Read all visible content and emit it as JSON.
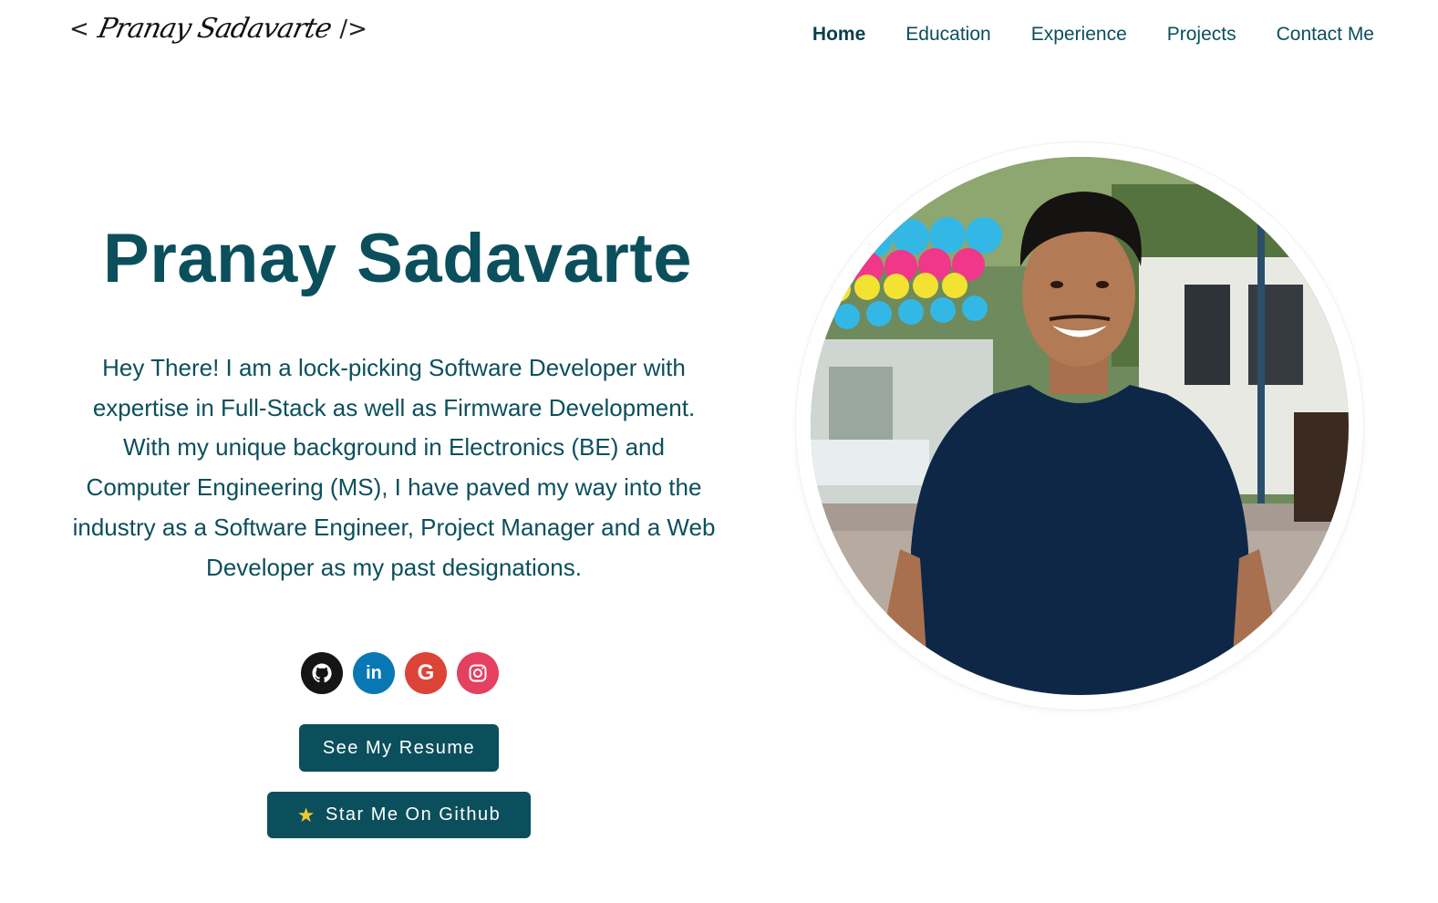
{
  "header": {
    "logo": {
      "open_bracket": "<",
      "signature": "Pranay Sadavarte",
      "close_bracket": "/>"
    },
    "nav": [
      {
        "label": "Home",
        "active": true
      },
      {
        "label": "Education",
        "active": false
      },
      {
        "label": "Experience",
        "active": false
      },
      {
        "label": "Projects",
        "active": false
      },
      {
        "label": "Contact Me",
        "active": false
      }
    ]
  },
  "hero": {
    "name": "Pranay Sadavarte",
    "bio": "Hey There! I am a lock-picking Software Developer with expertise in Full-Stack as well as Firmware Development. With my unique background in Electronics (BE) and Computer Engineering (MS), I have paved my way into the industry as a Software Engineer, Project Manager and a Web Developer as my past designations.",
    "socials": [
      {
        "icon": "github-icon",
        "color": "#151515"
      },
      {
        "icon": "linkedin-icon",
        "color": "#0a77b5"
      },
      {
        "icon": "google-icon",
        "color": "#db4437"
      },
      {
        "icon": "instagram-icon",
        "color": "#e4405f"
      }
    ],
    "resume_button": "See My Resume",
    "github_button": "Star Me On Github",
    "github_button_icon": "star-icon"
  },
  "photo": {
    "icon": "profile-photo"
  },
  "colors": {
    "primary": "#0b4f5c",
    "background": "#ffffff",
    "star": "#f4c430"
  }
}
